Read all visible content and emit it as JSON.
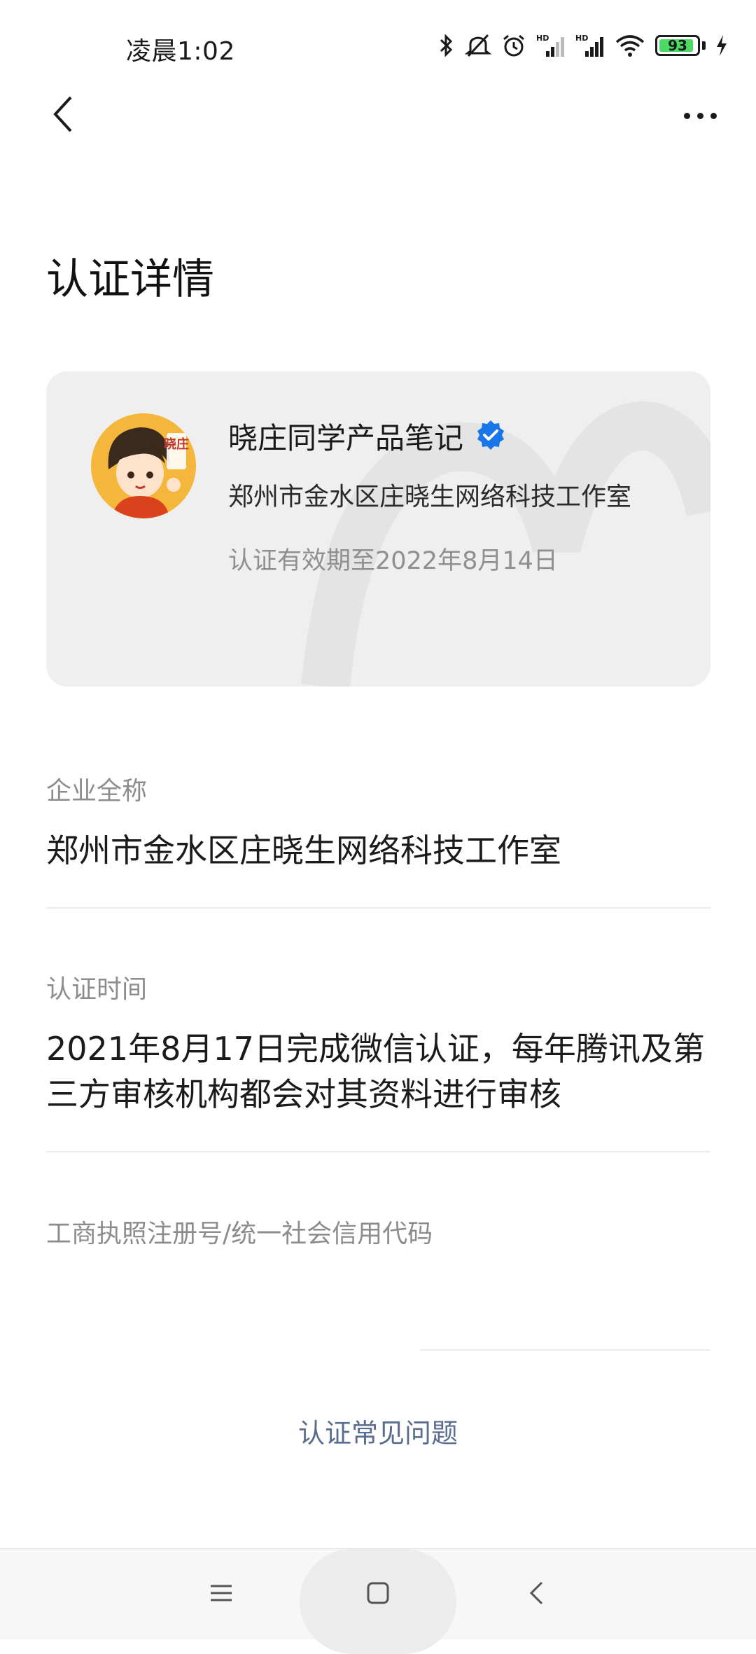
{
  "status_bar": {
    "time": "凌晨1:02",
    "battery_level": "93",
    "battery_fraction": 0.93,
    "icons": [
      "bluetooth-icon",
      "mute-icon",
      "alarm-icon",
      "hd-signal-icon",
      "hd-signal-icon",
      "wifi-icon",
      "battery-icon",
      "charging-icon"
    ],
    "battery_color": "#4cd964"
  },
  "header": {
    "back_icon": "chevron-left-icon",
    "more_icon": "more-dots-icon",
    "title": "认证详情"
  },
  "card": {
    "avatar_text": "晓庄",
    "name": "晓庄同学产品笔记",
    "verified_icon": "verified-badge-icon",
    "verified_color": "#1976e8",
    "company": "郑州市金水区庄晓生网络科技工作室",
    "validity": "认证有效期至2022年8月14日"
  },
  "sections": {
    "company_full_name": {
      "label": "企业全称",
      "value": "郑州市金水区庄晓生网络科技工作室"
    },
    "certification_time": {
      "label": "认证时间",
      "value": "2021年8月17日完成微信认证，每年腾讯及第三方审核机构都会对其资料进行审核"
    },
    "registration_number": {
      "label": "工商执照注册号/统一社会信用代码",
      "value": ""
    }
  },
  "faq_link": "认证常见问题",
  "nav_bar": {
    "menu_icon": "menu-icon",
    "home_icon": "home-square-icon",
    "back_icon": "back-triangle-icon"
  }
}
